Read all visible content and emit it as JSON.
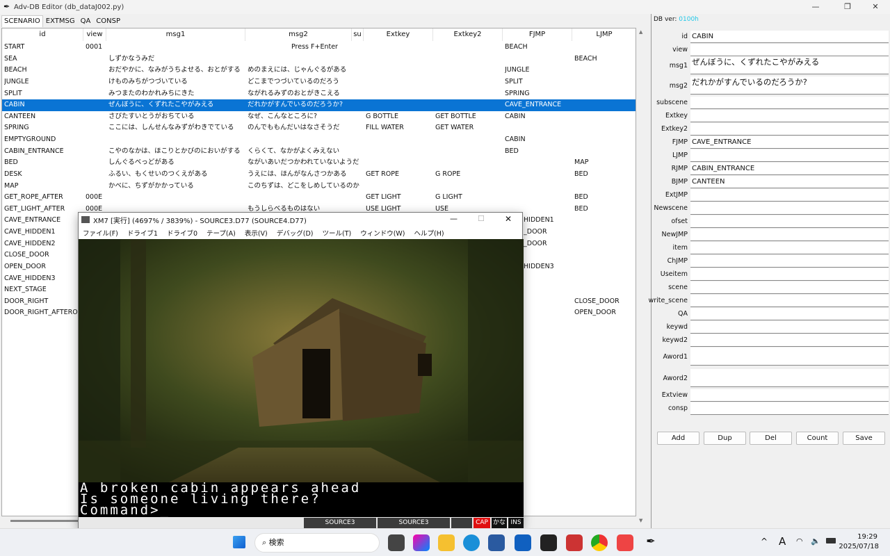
{
  "window": {
    "title": "Adv-DB Editor  (db_dataJ002.py)",
    "minimize": "—",
    "maximize": "❐",
    "close": "✕"
  },
  "tabs": [
    "SCENARIO",
    "EXTMSG",
    "QA",
    "CONSP"
  ],
  "table": {
    "columns": [
      "id",
      "view",
      "msg1",
      "msg2",
      "su",
      "Extkey",
      "Extkey2",
      "FJMP",
      "LJMP"
    ],
    "selected_index": 5,
    "rows": [
      [
        "START",
        "0001",
        "",
        "Press F+Enter",
        "",
        "",
        "",
        "BEACH",
        ""
      ],
      [
        "SEA",
        "",
        "しずかなうみだ",
        "",
        "",
        "",
        "",
        "",
        "BEACH"
      ],
      [
        "BEACH",
        "",
        "おだやかに、なみがうちよせる、おとがする",
        "めのまえには、じゃんぐるがある",
        "",
        "",
        "",
        "JUNGLE",
        ""
      ],
      [
        "JUNGLE",
        "",
        "けものみちがつづいている",
        "どこまでつづいているのだろう",
        "",
        "",
        "",
        "SPLIT",
        ""
      ],
      [
        "SPLIT",
        "",
        "みつまたのわかれみちにきた",
        "ながれるみずのおとがきこえる",
        "",
        "",
        "",
        "SPRING",
        ""
      ],
      [
        "CABIN",
        "",
        "ぜんぼうに、くずれたこやがみえる",
        "だれかがすんでいるのだろうか?",
        "",
        "",
        "",
        "CAVE_ENTRANCE",
        ""
      ],
      [
        "CANTEEN",
        "",
        "さびたすいとうがおちている",
        "なぜ、こんなところに?",
        "",
        "G BOTTLE",
        "GET BOTTLE",
        "CABIN",
        ""
      ],
      [
        "SPRING",
        "",
        "ここには、しんせんなみずがわきでている",
        "のんでももんだいはなさそうだ",
        "",
        "FILL WATER",
        "GET WATER",
        "",
        ""
      ],
      [
        "EMPTYGROUND",
        "",
        "",
        "",
        "",
        "",
        "",
        "CABIN",
        ""
      ],
      [
        "CABIN_ENTRANCE",
        "",
        "こやのなかは、ほこりとかびのにおいがする",
        "くらくて、なかがよくみえない",
        "",
        "",
        "",
        "BED",
        ""
      ],
      [
        "BED",
        "",
        "しんぐるべっどがある",
        "ながいあいだつかわれていないようだ",
        "",
        "",
        "",
        "",
        "MAP"
      ],
      [
        "DESK",
        "",
        "ふるい、もくせいのつくえがある",
        "うえには、ほんがなんさつかある",
        "",
        "GET ROPE",
        "G ROPE",
        "",
        "BED"
      ],
      [
        "MAP",
        "",
        "かべに、ちずがかかっている",
        "このちずは、どこをしめしているのか",
        "",
        "",
        "",
        "",
        ""
      ],
      [
        "GET_ROPE_AFTER",
        "000E",
        "",
        "",
        "",
        "GET LIGHT",
        "G LIGHT",
        "",
        "BED"
      ],
      [
        "GET_LIGHT_AFTER",
        "000E",
        "",
        "もうしらべるものはない",
        "",
        "USE LIGHT",
        "USE",
        "",
        "BED"
      ],
      [
        "CAVE_ENTRANCE",
        "",
        "",
        "",
        "",
        "",
        "",
        "HIDDEN1",
        ""
      ],
      [
        "CAVE_HIDDEN1",
        "",
        "",
        "",
        "",
        "",
        "",
        "_DOOR",
        ""
      ],
      [
        "CAVE_HIDDEN2",
        "",
        "",
        "",
        "",
        "",
        "",
        "_DOOR",
        ""
      ],
      [
        "CLOSE_DOOR",
        "",
        "",
        "",
        "",
        "",
        "",
        "",
        ""
      ],
      [
        "OPEN_DOOR",
        "",
        "",
        "",
        "",
        "",
        "",
        "HIDDEN3",
        ""
      ],
      [
        "CAVE_HIDDEN3",
        "",
        "",
        "",
        "",
        "",
        "",
        "",
        ""
      ],
      [
        "NEXT_STAGE",
        "",
        "",
        "",
        "",
        "",
        "",
        "",
        ""
      ],
      [
        "DOOR_RIGHT",
        "",
        "",
        "",
        "",
        "",
        "",
        "",
        "CLOSE_DOOR"
      ],
      [
        "DOOR_RIGHT_AFTEROP",
        "",
        "",
        "",
        "",
        "",
        "",
        "",
        "OPEN_DOOR"
      ]
    ]
  },
  "panel": {
    "db_ver_label": "DB ver:",
    "db_ver": "0100h",
    "db_ver_color": "#22c8e8",
    "fields": [
      {
        "label": "id",
        "value": "CABIN"
      },
      {
        "label": "view",
        "value": ""
      },
      {
        "label": "msg1",
        "value": "ぜんぼうに、くずれたこやがみえる"
      },
      {
        "label": "msg2",
        "value": "だれかがすんでいるのだろうか?"
      },
      {
        "label": "subscene",
        "value": ""
      },
      {
        "label": "Extkey",
        "value": ""
      },
      {
        "label": "Extkey2",
        "value": ""
      },
      {
        "label": "FJMP",
        "value": "CAVE_ENTRANCE"
      },
      {
        "label": "LJMP",
        "value": ""
      },
      {
        "label": "RJMP",
        "value": "CABIN_ENTRANCE"
      },
      {
        "label": "BJMP",
        "value": "CANTEEN"
      },
      {
        "label": "ExtJMP",
        "value": ""
      },
      {
        "label": "Newscene",
        "value": ""
      },
      {
        "label": "ofset",
        "value": ""
      },
      {
        "label": "NewJMP",
        "value": ""
      },
      {
        "label": "item",
        "value": ""
      },
      {
        "label": "ChJMP",
        "value": ""
      },
      {
        "label": "Useitem",
        "value": ""
      },
      {
        "label": "scene",
        "value": ""
      },
      {
        "label": "write_scene",
        "value": ""
      },
      {
        "label": "QA",
        "value": ""
      },
      {
        "label": "keywd",
        "value": ""
      },
      {
        "label": "keywd2",
        "value": ""
      },
      {
        "label": "Aword1",
        "value": ""
      },
      {
        "label": "Aword2",
        "value": ""
      },
      {
        "label": "Extview",
        "value": ""
      },
      {
        "label": "consp",
        "value": ""
      }
    ],
    "buttons": [
      "Add",
      "Dup",
      "Del",
      "Count",
      "Save"
    ]
  },
  "xm7": {
    "title": "XM7 [実行] (4697% / 3839%) - SOURCE3.D77 (SOURCE4.D77)",
    "menu": [
      "ファイル(F)",
      "ドライブ1",
      "ドライブ0",
      "テープ(A)",
      "表示(V)",
      "デバッグ(D)",
      "ツール(T)",
      "ウィンドウ(W)",
      "ヘルプ(H)"
    ],
    "screen_lines": [
      "A broken cabin appears ahead",
      "Is someone living there?",
      "Command>_"
    ],
    "status": [
      "SOURCE3",
      "SOURCE3",
      "",
      "CAP",
      "かな",
      "INS"
    ],
    "cap_color": "#e01010"
  },
  "taskbar": {
    "search_placeholder": "検索",
    "time": "19:29",
    "date": "2025/07/18",
    "ime": "A"
  }
}
